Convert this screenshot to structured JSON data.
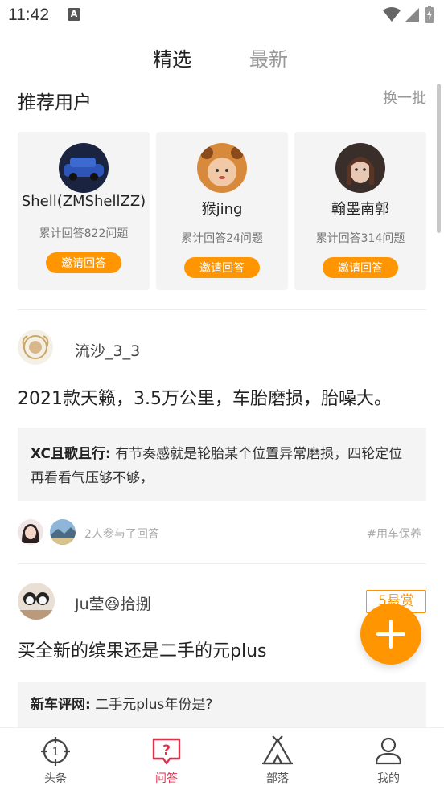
{
  "status_bar": {
    "time": "11:42",
    "notification_icon": "A"
  },
  "top_tabs": [
    {
      "label": "精选",
      "active": true
    },
    {
      "label": "最新",
      "active": false
    }
  ],
  "recommended": {
    "title": "推荐用户",
    "refresh_label": "换一批",
    "users": [
      {
        "name": "Shell(ZMShellZZ)",
        "stat": "累计回答822问题",
        "invite_label": "邀请回答"
      },
      {
        "name": "猴jing",
        "stat": "累计回答24问题",
        "invite_label": "邀请回答"
      },
      {
        "name": "翰墨南郭",
        "stat": "累计回答314问题",
        "invite_label": "邀请回答"
      }
    ]
  },
  "posts": [
    {
      "author": "流沙_3_3",
      "question": "2021款天籁，3.5万公里，车胎磨损，胎噪大。",
      "answer_author": "XC且歌且行:",
      "answer_text": "有节奏感就是轮胎某个位置异常磨损，四轮定位再看看气压够不够，",
      "participants_text": "2人参与了回答",
      "tag": "#用车保养"
    },
    {
      "author": "Ju莹😆拾捌",
      "bounty": "5悬赏",
      "question": "买全新的缤果还是二手的元plus",
      "answer_author": "新车评网:",
      "answer_text": "二手元plus年份是?"
    }
  ],
  "bottom_nav": [
    {
      "label": "头条",
      "icon": "target-icon",
      "active": false
    },
    {
      "label": "问答",
      "icon": "question-bubble-icon",
      "active": true
    },
    {
      "label": "部落",
      "icon": "tent-icon",
      "active": false
    },
    {
      "label": "我的",
      "icon": "person-icon",
      "active": false
    }
  ],
  "colors": {
    "accent": "#ff9500",
    "nav_active": "#e0304a"
  }
}
